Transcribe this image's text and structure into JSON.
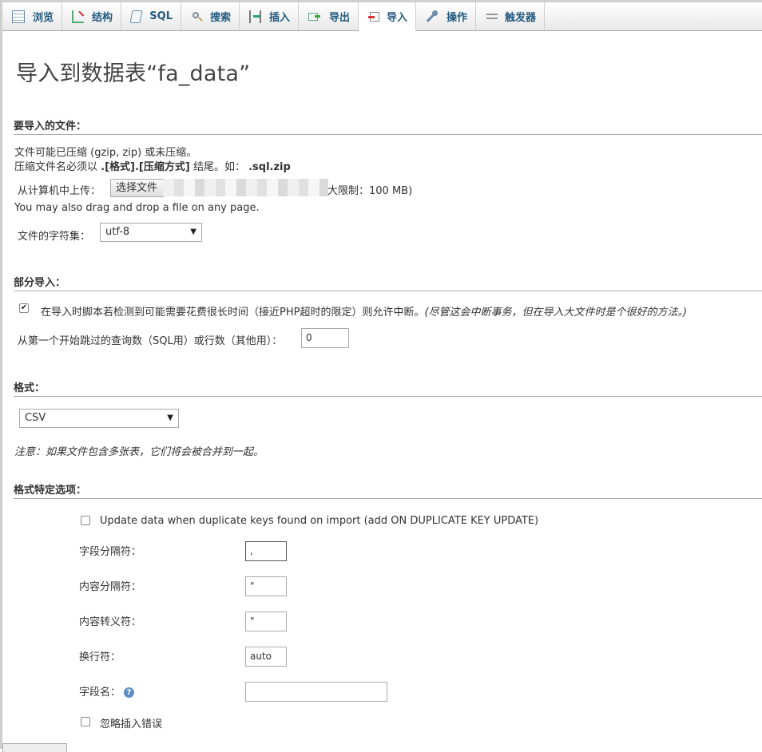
{
  "tabs": [
    {
      "label": "浏览",
      "icon": "browse-icon",
      "active": false
    },
    {
      "label": "结构",
      "icon": "structure-icon",
      "active": false
    },
    {
      "label": "SQL",
      "icon": "sql-icon",
      "active": false
    },
    {
      "label": "搜索",
      "icon": "search-icon",
      "active": false
    },
    {
      "label": "插入",
      "icon": "insert-icon",
      "active": false
    },
    {
      "label": "导出",
      "icon": "export-icon",
      "active": false
    },
    {
      "label": "导入",
      "icon": "import-icon",
      "active": true
    },
    {
      "label": "操作",
      "icon": "operations-icon",
      "active": false
    },
    {
      "label": "触发器",
      "icon": "triggers-icon",
      "active": false
    }
  ],
  "title": "导入到数据表“fa_data”",
  "file_section": {
    "heading": "要导入的文件：",
    "compress_note": "文件可能已压缩 (gzip, zip) 或未压缩。",
    "name_note_prefix": "压缩文件名必须以",
    "name_note_bold": ".[格式].[压缩方式]",
    "name_note_mid": "结尾。如：",
    "name_note_example": ".sql.zip",
    "upload_label": "从计算机中上传：",
    "choose_file_button": "选择文件",
    "max_size": "大限制：100 MB)",
    "drag_note": "You may also drag and drop a file on any page.",
    "charset_label": "文件的字符集：",
    "charset_value": "utf-8"
  },
  "partial_section": {
    "heading": "部分导入：",
    "interrupt_checked": true,
    "interrupt_label": "在导入时脚本若检测到可能需要花费很长时间（接近PHP超时的限定）则允许中断。",
    "interrupt_note": "(尽管这会中断事务，但在导入大文件时是个很好的方法。)",
    "skip_label": "从第一个开始跳过的查询数（SQL用）或行数（其他用）：",
    "skip_value": "0"
  },
  "format_section": {
    "heading": "格式：",
    "format_value": "CSV",
    "note": "注意：如果文件包含多张表，它们将会被合并到一起。"
  },
  "options_section": {
    "heading": "格式特定选项：",
    "update_checked": false,
    "update_label": "Update data when duplicate keys found on import (add ON DUPLICATE KEY UPDATE)",
    "field_sep_label": "字段分隔符：",
    "field_sep_value": ",",
    "enclosed_label": "内容分隔符：",
    "enclosed_value": "\"",
    "escaped_label": "内容转义符：",
    "escaped_value": "\"",
    "line_term_label": "换行符：",
    "line_term_value": "auto",
    "col_names_label": "字段名：",
    "col_names_value": "",
    "ignore_checked": false,
    "ignore_label": "忽略插入错误"
  },
  "colors": {
    "tab_text": "#235a81",
    "heading_border": "#aaaaaa",
    "help_icon": "#5b8ec4"
  }
}
